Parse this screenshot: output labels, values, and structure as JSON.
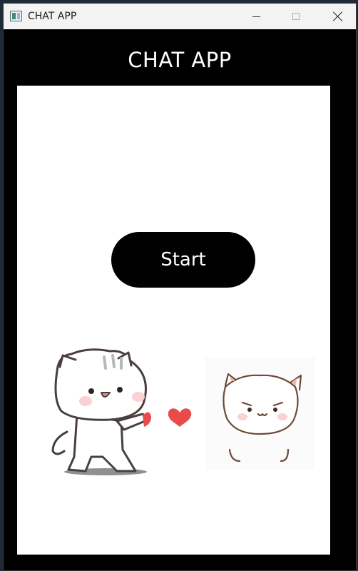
{
  "window": {
    "title": "CHAT APP"
  },
  "header": {
    "title": "CHAT APP"
  },
  "main": {
    "start_label": "Start"
  },
  "colors": {
    "header_bg": "#000000",
    "panel_bg": "#ffffff",
    "button_bg": "#000000",
    "button_text": "#ffffff",
    "heart": "#e94b4b"
  },
  "icons": [
    "app-icon",
    "minimize-icon",
    "maximize-icon",
    "close-icon"
  ]
}
